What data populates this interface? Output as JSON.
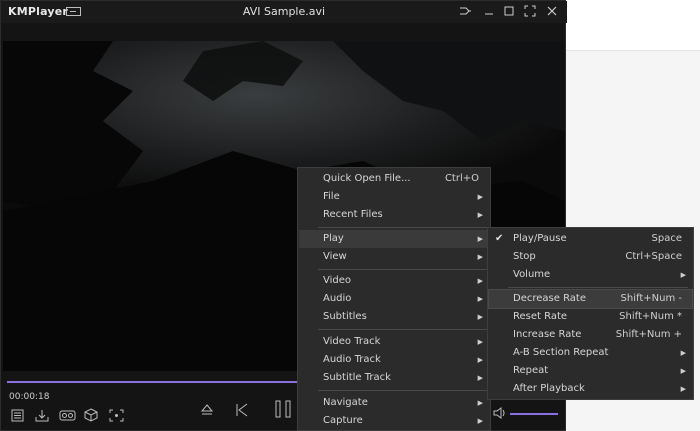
{
  "app": {
    "brand": "KMPlayer",
    "title": "AVI Sample.avi"
  },
  "player": {
    "time": "00:00:18"
  },
  "colors": {
    "accent": "#8b6fe0",
    "menu_bg": "#2b2b2b",
    "window_bg": "#141414"
  },
  "titlebar_icons": [
    "pin-icon",
    "minimize-icon",
    "maximize-icon",
    "fullscreen-icon",
    "close-icon"
  ],
  "context_menu": {
    "items": [
      {
        "label": "Quick Open File...",
        "shortcut": "Ctrl+O"
      },
      {
        "label": "File"
      },
      {
        "label": "Recent Files"
      },
      {
        "label": "Play"
      },
      {
        "label": "View"
      },
      {
        "label": "Video"
      },
      {
        "label": "Audio"
      },
      {
        "label": "Subtitles"
      },
      {
        "label": "Video Track"
      },
      {
        "label": "Audio Track"
      },
      {
        "label": "Subtitle Track"
      },
      {
        "label": "Navigate"
      },
      {
        "label": "Capture"
      }
    ]
  },
  "play_submenu": {
    "items": [
      {
        "label": "Play/Pause",
        "shortcut": "Space",
        "checked": true
      },
      {
        "label": "Stop",
        "shortcut": "Ctrl+Space"
      },
      {
        "label": "Volume"
      },
      {
        "label": "Decrease Rate",
        "shortcut": "Shift+Num -"
      },
      {
        "label": "Reset Rate",
        "shortcut": "Shift+Num *"
      },
      {
        "label": "Increase Rate",
        "shortcut": "Shift+Num +"
      },
      {
        "label": "A-B Section Repeat"
      },
      {
        "label": "Repeat"
      },
      {
        "label": "After Playback"
      }
    ]
  }
}
